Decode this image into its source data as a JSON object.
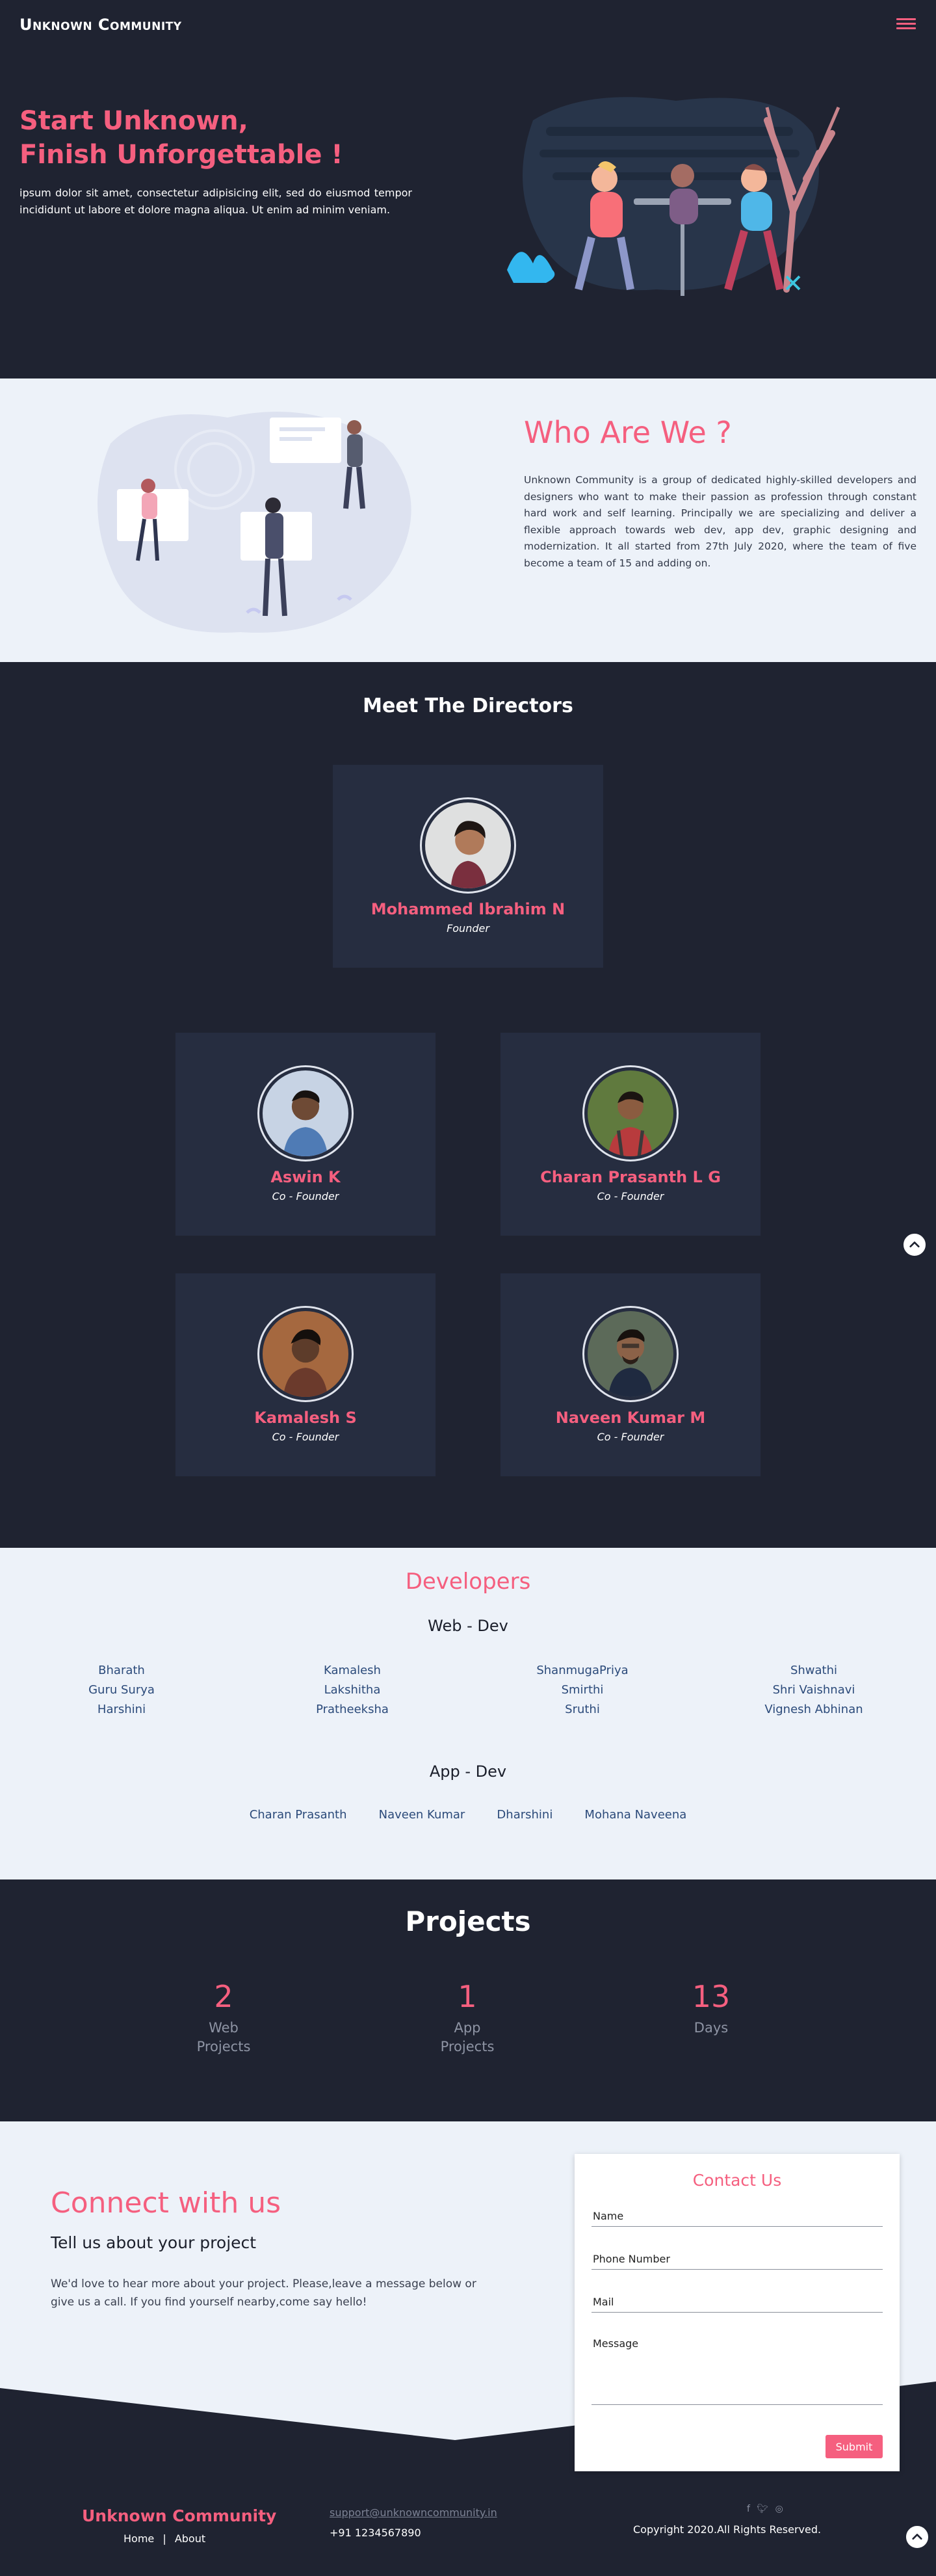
{
  "nav": {
    "brand": "Unknown Community",
    "menu_icon": "hamburger-icon"
  },
  "hero": {
    "title_line1": "Start Unknown,",
    "title_line2": "Finish Unforgettable !",
    "text": "ipsum dolor sit amet, consectetur adipisicing elit, sed do eiusmod tempor incididunt ut labore et dolore magna aliqua. Ut enim ad minim veniam."
  },
  "about": {
    "title": "Who Are We ?",
    "text": "Unknown Community is a group of dedicated highly-skilled developers and designers who want to make their passion as profession through constant hard work and self learning. Principally we are specializing and deliver a flexible approach towards web dev, app dev, graphic designing and modernization. It all started from 27th July 2020, where the team of five become a team of 15 and adding on."
  },
  "directors": {
    "title": "Meet The Directors",
    "founder": {
      "name": "Mohammed Ibrahim N",
      "role": "Founder"
    },
    "cofounders": [
      {
        "name": "Aswin K",
        "role": "Co - Founder"
      },
      {
        "name": "Charan Prasanth L G",
        "role": "Co - Founder"
      },
      {
        "name": "Kamalesh S",
        "role": "Co - Founder"
      },
      {
        "name": "Naveen Kumar M",
        "role": "Co - Founder"
      }
    ]
  },
  "developers": {
    "title": "Developers",
    "web_title": "Web - Dev",
    "web_columns": [
      [
        "Bharath",
        "Guru Surya",
        "Harshini"
      ],
      [
        "Kamalesh",
        "Lakshitha",
        "Pratheeksha"
      ],
      [
        "ShanmugaPriya",
        "Smirthi",
        "Sruthi"
      ],
      [
        "Shwathi",
        "Shri Vaishnavi",
        "Vignesh Abhinan"
      ]
    ],
    "app_title": "App - Dev",
    "app_names": [
      "Charan Prasanth",
      "Naveen Kumar",
      "Dharshini",
      "Mohana Naveena"
    ]
  },
  "projects": {
    "title": "Projects",
    "stats": [
      {
        "value": "2",
        "label_line1": "Web",
        "label_line2": "Projects"
      },
      {
        "value": "1",
        "label_line1": "App",
        "label_line2": "Projects"
      },
      {
        "value": "13",
        "label_line1": "Days",
        "label_line2": ""
      }
    ]
  },
  "contact": {
    "title": "Connect with us",
    "subtitle": "Tell us about your project",
    "text": "We'd love to hear more about your project. Please,leave a message below or give us a call. If you find yourself nearby,come say hello!",
    "form_title": "Contact Us",
    "name_placeholder": "Name",
    "phone_placeholder": "Phone Number",
    "mail_placeholder": "Mail",
    "message_placeholder": "Message",
    "submit_label": "Submit"
  },
  "footer": {
    "brand": "Unknown Community",
    "home_link": "Home",
    "separator": "|",
    "about_link": "About",
    "email": "support@unknowncommunity.in",
    "phone": "+91 1234567890",
    "social_icons": [
      "facebook-icon",
      "twitter-icon",
      "instagram-icon"
    ],
    "copyright": "Copyright 2020.All Rights Reserved."
  },
  "colors": {
    "accent": "#f55f7f",
    "dark_bg": "#1f2331",
    "card_bg": "#262d40",
    "light_bg": "#edf2f9",
    "name_blue": "#2b4a7a"
  }
}
